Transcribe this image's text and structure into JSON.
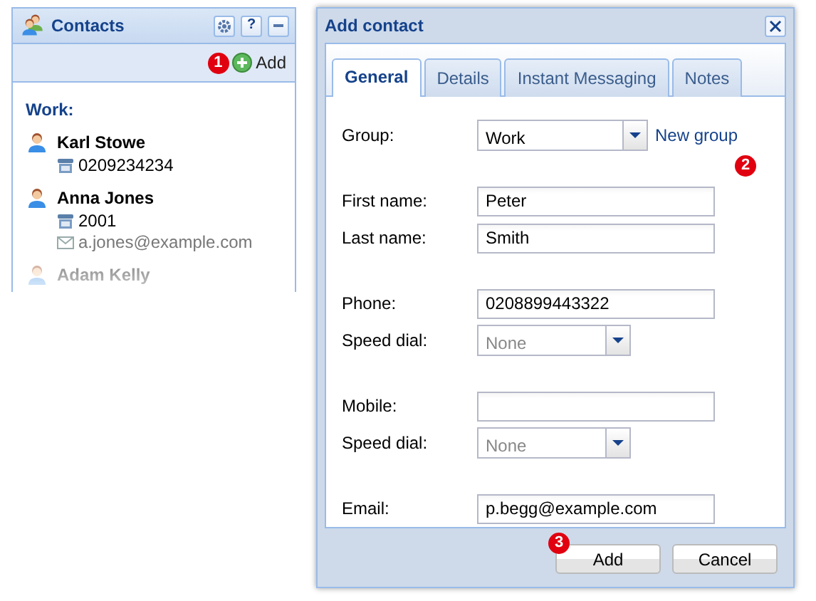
{
  "contacts_panel": {
    "title": "Contacts",
    "tool_buttons": [
      {
        "kind": "gear"
      },
      {
        "kind": "help",
        "label": "?"
      },
      {
        "kind": "minimize"
      }
    ],
    "callout": "1",
    "add_label": "Add",
    "group": "Work:",
    "contacts": [
      {
        "name": "Karl Stowe",
        "faded": false,
        "details": [
          {
            "kind": "phone",
            "text": "0209234234"
          }
        ]
      },
      {
        "name": "Anna Jones",
        "faded": false,
        "details": [
          {
            "kind": "phone",
            "text": "2001"
          },
          {
            "kind": "email",
            "text": "a.jones@example.com"
          }
        ]
      },
      {
        "name": "Adam Kelly",
        "faded": true
      }
    ]
  },
  "dialog": {
    "title": "Add contact",
    "tabs": [
      {
        "label": "General",
        "selected": true
      },
      {
        "label": "Details",
        "selected": false
      },
      {
        "label": "Instant Messaging",
        "selected": false
      },
      {
        "label": "Notes",
        "selected": false
      }
    ],
    "callout": "2",
    "sections": [
      [
        {
          "kind": "select",
          "label": "Group:",
          "value": "Work",
          "disabled": false,
          "link": "New group"
        }
      ],
      [
        {
          "kind": "text",
          "label": "First name:",
          "value": "Peter"
        },
        {
          "kind": "text",
          "label": "Last name:",
          "value": "Smith"
        }
      ],
      [
        {
          "kind": "text",
          "label": "Phone:",
          "value": "0208899443322"
        },
        {
          "kind": "select",
          "label": "Speed dial:",
          "value": "None",
          "disabled": true
        }
      ],
      [
        {
          "kind": "text",
          "label": "Mobile:"
        },
        {
          "kind": "select",
          "label": "Speed dial:",
          "value": "None",
          "disabled": true
        }
      ],
      [
        {
          "kind": "text",
          "label": "Email:",
          "value": "p.begg@example.com"
        }
      ]
    ],
    "buttons": [
      {
        "label": "Add",
        "callout": "3"
      },
      {
        "label": "Cancel"
      }
    ]
  }
}
